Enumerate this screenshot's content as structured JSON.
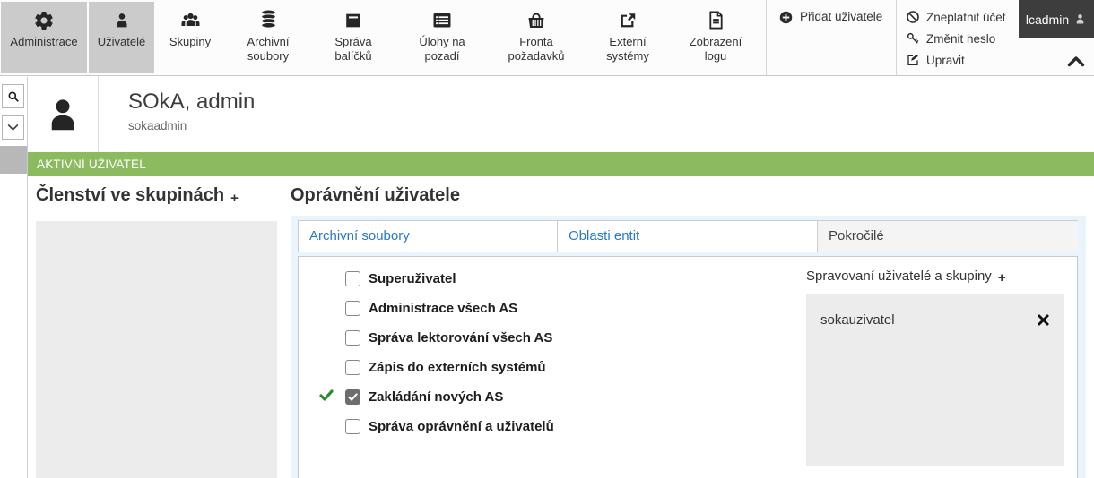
{
  "toolbar": {
    "items": [
      {
        "label": "Administrace",
        "icon": "gear-icon",
        "active": true
      },
      {
        "label": "Uživatelé",
        "icon": "user-icon",
        "active": true
      },
      {
        "label": "Skupiny",
        "icon": "users-group-icon",
        "active": false
      },
      {
        "label": "Archivní soubory",
        "icon": "database-icon",
        "active": false
      },
      {
        "label": "Správa balíčků",
        "icon": "package-box-icon",
        "active": false
      },
      {
        "label": "Úlohy na pozadí",
        "icon": "task-list-icon",
        "active": false
      },
      {
        "label": "Fronta požadavků",
        "icon": "basket-icon",
        "active": false
      },
      {
        "label": "Externí systémy",
        "icon": "external-link-icon",
        "active": false
      },
      {
        "label": "Zobrazení logu",
        "icon": "document-icon",
        "active": false
      }
    ],
    "add_user_label": "Přidat uživatele",
    "actions": [
      {
        "label": "Zneplatnit účet",
        "icon": "ban-circle-icon"
      },
      {
        "label": "Změnit heslo",
        "icon": "key-icon"
      },
      {
        "label": "Upravit",
        "icon": "edit-pencil-icon"
      }
    ],
    "user_badge": "lcadmin"
  },
  "profile": {
    "name": "SOkA, admin",
    "username": "sokaadmin",
    "status": "AKTIVNÍ UŽIVATEL"
  },
  "groups_panel": {
    "title": "Členství ve skupinách",
    "add_label": "+"
  },
  "permissions": {
    "title": "Oprávnění uživatele",
    "tabs": [
      {
        "label": "Archivní soubory",
        "active": false
      },
      {
        "label": "Oblasti entit",
        "active": false
      },
      {
        "label": "Pokročilé",
        "active": true
      }
    ],
    "checkboxes": [
      {
        "label": "Superuživatel",
        "checked": false
      },
      {
        "label": "Administrace všech AS",
        "checked": false
      },
      {
        "label": "Správa lektorování všech AS",
        "checked": false
      },
      {
        "label": "Zápis do externích systémů",
        "checked": false
      },
      {
        "label": "Zakládání nových AS",
        "checked": true
      },
      {
        "label": "Správa oprávnění a uživatelů",
        "checked": false
      }
    ],
    "managed_panel": {
      "title": "Spravovaní uživatelé a skupiny",
      "add_label": "+",
      "items": [
        {
          "label": "sokauzivatel"
        }
      ]
    }
  },
  "colors": {
    "status_green": "#8cbb5f",
    "tab_link_blue": "#2779c7",
    "active_item_gray": "#cbcbcb",
    "badge_dark": "#3d3d3d",
    "check_green": "#2e8b2e"
  }
}
